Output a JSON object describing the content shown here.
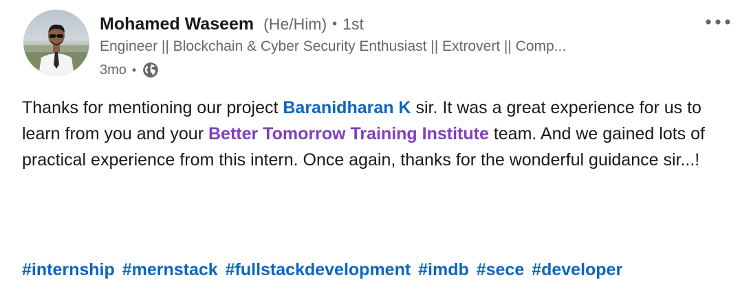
{
  "author": {
    "name": "Mohamed Waseem",
    "pronouns": "(He/Him)",
    "separator": "•",
    "connection_degree": "1st",
    "headline": "Engineer || Blockchain & Cyber Security Enthusiast || Extrovert || Comp...",
    "timestamp": "3mo",
    "visibility_icon": "globe-icon",
    "avatar_icon": "profile-photo"
  },
  "post": {
    "text_1": "Thanks for mentioning our project ",
    "mention_person": "Baranidharan K",
    "text_2": " sir. It was a great experience for us to learn from you and your ",
    "mention_company": "Better Tomorrow Training Institute",
    "text_3": " team. And we gained lots of practical experience from this intern. Once again, thanks for the wonderful guidance sir...!",
    "hashtags": [
      "#internship",
      "#mernstack",
      "#fullstackdevelopment",
      "#imdb",
      "#sece",
      "#developer"
    ]
  },
  "controls": {
    "more_icon": "more-horizontal-icon"
  },
  "colors": {
    "link": "#0a66c2",
    "company_link": "#7f3fbf",
    "secondary_text": "#666666",
    "primary_text": "#191919"
  }
}
